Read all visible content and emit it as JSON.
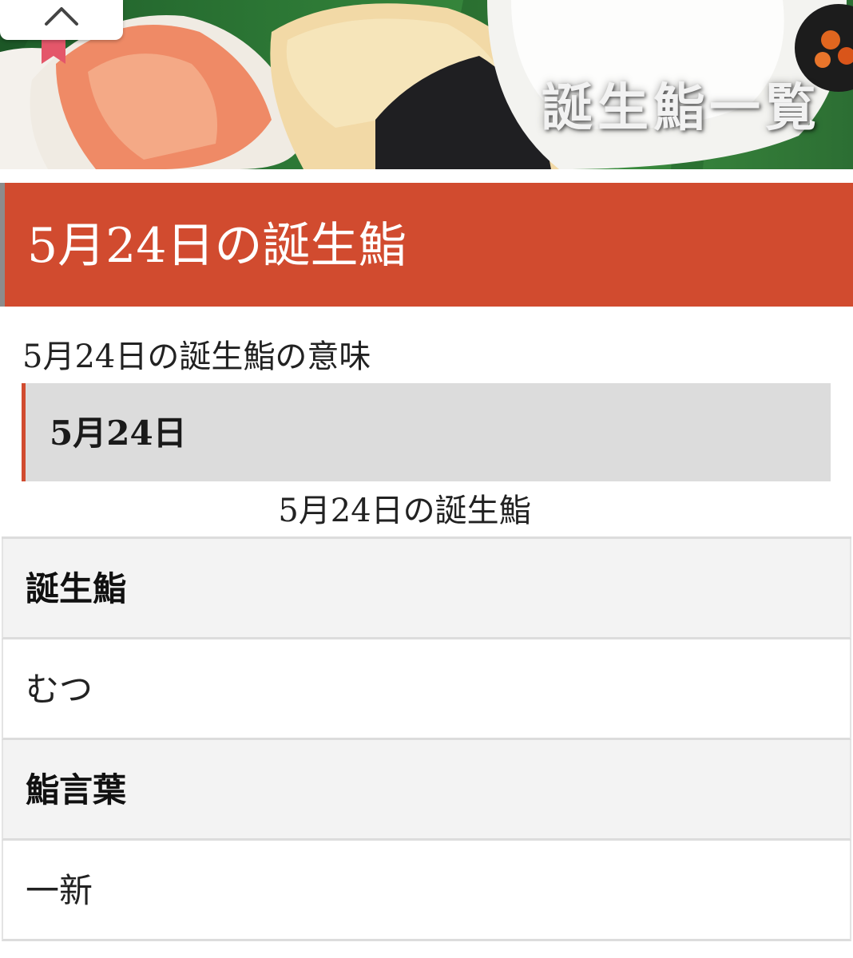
{
  "banner": {
    "title": "誕生鮨一覧",
    "back_to_top_icon": "chevron-up-icon"
  },
  "heading": {
    "title": "5月24日の誕生鮨"
  },
  "meaning": {
    "title": "5月24日の誕生鮨の意味"
  },
  "date_box": {
    "label": "5月24日"
  },
  "table": {
    "caption": "5月24日の誕生鮨",
    "rows": [
      {
        "header": "誕生鮨",
        "value": "むつ"
      },
      {
        "header": "鮨言葉",
        "value": "一新"
      }
    ]
  },
  "colors": {
    "accent": "#d14b2f",
    "box_gray": "#dcdcdc",
    "table_head": "#f3f3f3"
  }
}
